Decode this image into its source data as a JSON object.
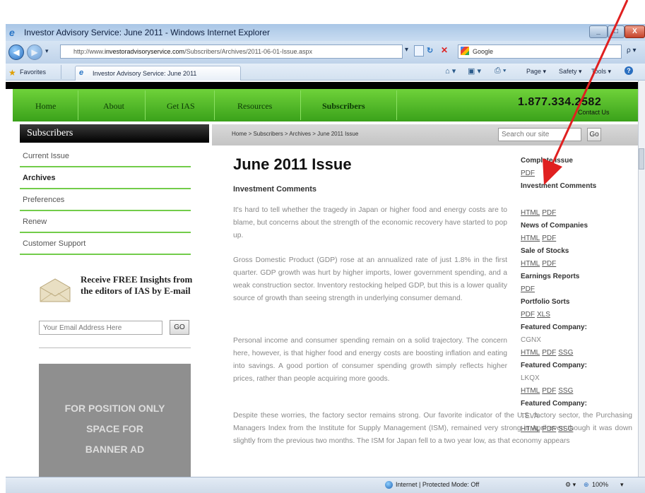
{
  "window": {
    "title": "Investor Advisory Service: June 2011 - Windows Internet Explorer",
    "controls": {
      "minimize": "_",
      "maximize": "□",
      "close": "X"
    }
  },
  "address_bar": {
    "url_prefix": "http://www.",
    "url_domain": "investoradvisoryservice.com",
    "url_path": "/Subscribers/Archives/2011-06-01-Issue.aspx",
    "search_engine": "Google",
    "search_suffix": "ρ ▾"
  },
  "favorites_bar": {
    "favorites_label": "Favorites",
    "tab_title": "Investor Advisory Service: June 2011",
    "commands": [
      "Page ▾",
      "Safety ▾",
      "Tools ▾"
    ]
  },
  "site_nav": {
    "items": [
      "Home",
      "About",
      "Get IAS",
      "Resources",
      "Subscribers"
    ],
    "phone": "1.877.334.2582",
    "contact": "Contact Us"
  },
  "sidebar": {
    "heading": "Subscribers",
    "items": [
      {
        "label": "Current Issue",
        "active": false
      },
      {
        "label": "Archives",
        "active": true
      },
      {
        "label": "Preferences",
        "active": false
      },
      {
        "label": "Renew",
        "active": false
      },
      {
        "label": "Customer Support",
        "active": false
      }
    ],
    "promo": "Receive FREE Insights from the editors of IAS by E-mail",
    "email_placeholder": "Your Email Address Here",
    "email_go": "GO",
    "banner_lines": [
      "FOR POSITION ONLY",
      "SPACE FOR",
      "BANNER AD"
    ]
  },
  "breadcrumb": {
    "text": "Home  >  Subscribers  >  Archives  >  June 2011 Issue",
    "search_placeholder": "Search our site",
    "search_go": "Go"
  },
  "article": {
    "title": "June 2011 Issue",
    "section": "Investment Comments",
    "paragraphs": [
      "It's hard to tell whether the tragedy in Japan or higher food and energy costs are to blame, but concerns about the strength of the economic recovery have started to pop up.",
      "Gross Domestic Product (GDP) rose at an annualized rate of just 1.8% in the first quarter. GDP growth was hurt by higher imports, lower government spending, and a weak construction sector. Inventory restocking helped GDP, but this is a lower quality source of growth than seeing strength in underlying consumer demand.",
      "Personal income and consumer spending remain on a solid trajectory. The concern here, however, is that higher food and energy costs are boosting inflation and eating into savings. A good portion of consumer spending growth simply reflects higher prices, rather than people acquiring more goods.",
      "Despite these worries, the factory sector remains strong. Our favorite indicator of the U.S. factory sector, the Purchasing Managers Index from the Institute for Supply Management (ISM), remained very strong in April even though it was down slightly from the previous two months. The ISM for Japan fell to a two year low, as that economy appears"
    ]
  },
  "issue_links": {
    "complete_issue": "Complete Issue",
    "complete_pdf": "PDF",
    "investment_comments": "Investment Comments",
    "news_of_companies": "News of Companies",
    "sale_of_stocks": "Sale of Stocks",
    "earnings_reports": "Earnings Reports",
    "portfolio_sorts": "Portfolio Sorts",
    "featured_label": "Featured Company:",
    "html": "HTML",
    "pdf": "PDF",
    "xls": "XLS",
    "ssg": "SSG",
    "featured_1": "CGNX",
    "featured_2": "LKQX",
    "featured_3": "TEVA"
  },
  "status_bar": {
    "zone": "Internet | Protected Mode: Off",
    "zoom": "100%"
  }
}
